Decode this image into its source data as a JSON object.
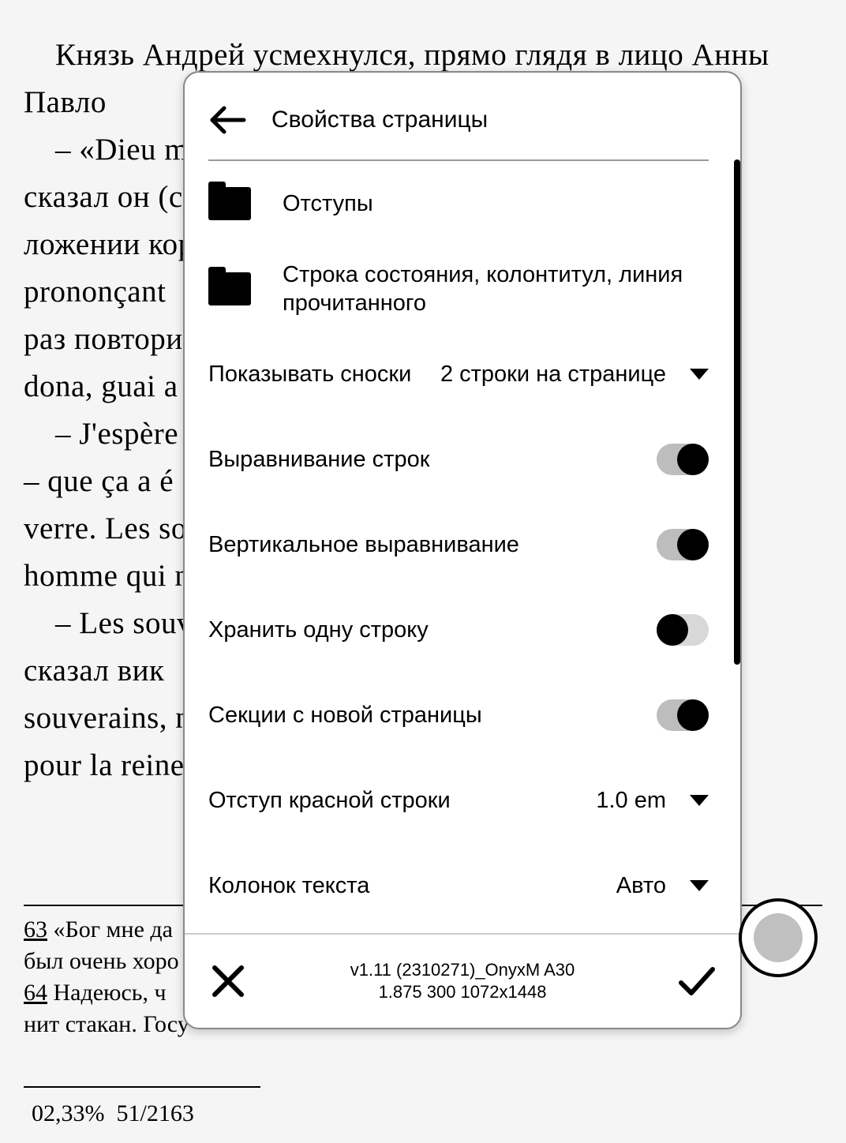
{
  "book": {
    "p1": "Князь Андрей усмехнулся, прямо глядя в лицо Анны Павло",
    "p2": "– «Dieu m",
    "p3": "сказал он (с",
    "p4": "ложении кор",
    "p5": "prononçant",
    "p6": "раз повтори",
    "p7": "dona, guai a",
    "p8": "– J'espère",
    "p9": "– que ça a é",
    "p10": "verre. Les so",
    "p11": "homme qui n",
    "p12": "– Les souv",
    "p13": "сказал вик",
    "p14": "souverains, n",
    "p15": "pour la reine"
  },
  "footnotes": {
    "n63_id": "63",
    "n63": "«Бог мне да",
    "n63b": "был очень хоро",
    "n64_id": "64",
    "n64": "Надеюсь, ч",
    "n64b": "нит стакан. Госу"
  },
  "status": {
    "percent": "02,33%",
    "pages": "51/2163"
  },
  "panel": {
    "title": "Свойства страницы",
    "items": {
      "indents": "Отступы",
      "statusline": "Строка состояния, колонтитул, линия прочитанного",
      "footnotes_label": "Показывать сноски",
      "footnotes_value": "2 строки на странице",
      "justify": "Выравнивание строк",
      "valign": "Вертикальное выравнивание",
      "keepone": "Хранить одну строку",
      "newpage": "Секции с новой страницы",
      "indent_label": "Отступ красной строки",
      "indent_value": "1.0 em",
      "columns_label": "Колонок текста",
      "columns_value": "Авто"
    },
    "toggles": {
      "justify": true,
      "valign": true,
      "keepone": false,
      "newpage": true
    }
  },
  "footer": {
    "line1": "v1.11 (2310271)_OnyxM A30",
    "line2": "1.875 300 1072x1448"
  }
}
